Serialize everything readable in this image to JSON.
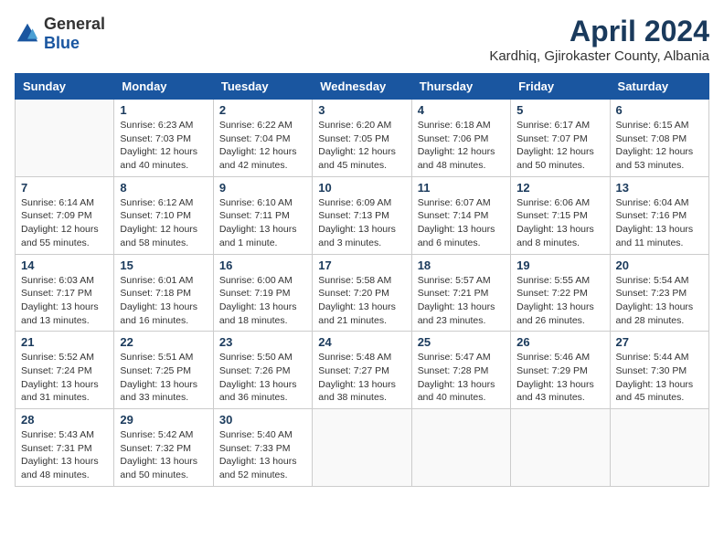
{
  "header": {
    "logo_general": "General",
    "logo_blue": "Blue",
    "month": "April 2024",
    "location": "Kardhiq, Gjirokaster County, Albania"
  },
  "weekdays": [
    "Sunday",
    "Monday",
    "Tuesday",
    "Wednesday",
    "Thursday",
    "Friday",
    "Saturday"
  ],
  "weeks": [
    [
      {
        "date": "",
        "sunrise": "",
        "sunset": "",
        "daylight": ""
      },
      {
        "date": "1",
        "sunrise": "Sunrise: 6:23 AM",
        "sunset": "Sunset: 7:03 PM",
        "daylight": "Daylight: 12 hours and 40 minutes."
      },
      {
        "date": "2",
        "sunrise": "Sunrise: 6:22 AM",
        "sunset": "Sunset: 7:04 PM",
        "daylight": "Daylight: 12 hours and 42 minutes."
      },
      {
        "date": "3",
        "sunrise": "Sunrise: 6:20 AM",
        "sunset": "Sunset: 7:05 PM",
        "daylight": "Daylight: 12 hours and 45 minutes."
      },
      {
        "date": "4",
        "sunrise": "Sunrise: 6:18 AM",
        "sunset": "Sunset: 7:06 PM",
        "daylight": "Daylight: 12 hours and 48 minutes."
      },
      {
        "date": "5",
        "sunrise": "Sunrise: 6:17 AM",
        "sunset": "Sunset: 7:07 PM",
        "daylight": "Daylight: 12 hours and 50 minutes."
      },
      {
        "date": "6",
        "sunrise": "Sunrise: 6:15 AM",
        "sunset": "Sunset: 7:08 PM",
        "daylight": "Daylight: 12 hours and 53 minutes."
      }
    ],
    [
      {
        "date": "7",
        "sunrise": "Sunrise: 6:14 AM",
        "sunset": "Sunset: 7:09 PM",
        "daylight": "Daylight: 12 hours and 55 minutes."
      },
      {
        "date": "8",
        "sunrise": "Sunrise: 6:12 AM",
        "sunset": "Sunset: 7:10 PM",
        "daylight": "Daylight: 12 hours and 58 minutes."
      },
      {
        "date": "9",
        "sunrise": "Sunrise: 6:10 AM",
        "sunset": "Sunset: 7:11 PM",
        "daylight": "Daylight: 13 hours and 1 minute."
      },
      {
        "date": "10",
        "sunrise": "Sunrise: 6:09 AM",
        "sunset": "Sunset: 7:13 PM",
        "daylight": "Daylight: 13 hours and 3 minutes."
      },
      {
        "date": "11",
        "sunrise": "Sunrise: 6:07 AM",
        "sunset": "Sunset: 7:14 PM",
        "daylight": "Daylight: 13 hours and 6 minutes."
      },
      {
        "date": "12",
        "sunrise": "Sunrise: 6:06 AM",
        "sunset": "Sunset: 7:15 PM",
        "daylight": "Daylight: 13 hours and 8 minutes."
      },
      {
        "date": "13",
        "sunrise": "Sunrise: 6:04 AM",
        "sunset": "Sunset: 7:16 PM",
        "daylight": "Daylight: 13 hours and 11 minutes."
      }
    ],
    [
      {
        "date": "14",
        "sunrise": "Sunrise: 6:03 AM",
        "sunset": "Sunset: 7:17 PM",
        "daylight": "Daylight: 13 hours and 13 minutes."
      },
      {
        "date": "15",
        "sunrise": "Sunrise: 6:01 AM",
        "sunset": "Sunset: 7:18 PM",
        "daylight": "Daylight: 13 hours and 16 minutes."
      },
      {
        "date": "16",
        "sunrise": "Sunrise: 6:00 AM",
        "sunset": "Sunset: 7:19 PM",
        "daylight": "Daylight: 13 hours and 18 minutes."
      },
      {
        "date": "17",
        "sunrise": "Sunrise: 5:58 AM",
        "sunset": "Sunset: 7:20 PM",
        "daylight": "Daylight: 13 hours and 21 minutes."
      },
      {
        "date": "18",
        "sunrise": "Sunrise: 5:57 AM",
        "sunset": "Sunset: 7:21 PM",
        "daylight": "Daylight: 13 hours and 23 minutes."
      },
      {
        "date": "19",
        "sunrise": "Sunrise: 5:55 AM",
        "sunset": "Sunset: 7:22 PM",
        "daylight": "Daylight: 13 hours and 26 minutes."
      },
      {
        "date": "20",
        "sunrise": "Sunrise: 5:54 AM",
        "sunset": "Sunset: 7:23 PM",
        "daylight": "Daylight: 13 hours and 28 minutes."
      }
    ],
    [
      {
        "date": "21",
        "sunrise": "Sunrise: 5:52 AM",
        "sunset": "Sunset: 7:24 PM",
        "daylight": "Daylight: 13 hours and 31 minutes."
      },
      {
        "date": "22",
        "sunrise": "Sunrise: 5:51 AM",
        "sunset": "Sunset: 7:25 PM",
        "daylight": "Daylight: 13 hours and 33 minutes."
      },
      {
        "date": "23",
        "sunrise": "Sunrise: 5:50 AM",
        "sunset": "Sunset: 7:26 PM",
        "daylight": "Daylight: 13 hours and 36 minutes."
      },
      {
        "date": "24",
        "sunrise": "Sunrise: 5:48 AM",
        "sunset": "Sunset: 7:27 PM",
        "daylight": "Daylight: 13 hours and 38 minutes."
      },
      {
        "date": "25",
        "sunrise": "Sunrise: 5:47 AM",
        "sunset": "Sunset: 7:28 PM",
        "daylight": "Daylight: 13 hours and 40 minutes."
      },
      {
        "date": "26",
        "sunrise": "Sunrise: 5:46 AM",
        "sunset": "Sunset: 7:29 PM",
        "daylight": "Daylight: 13 hours and 43 minutes."
      },
      {
        "date": "27",
        "sunrise": "Sunrise: 5:44 AM",
        "sunset": "Sunset: 7:30 PM",
        "daylight": "Daylight: 13 hours and 45 minutes."
      }
    ],
    [
      {
        "date": "28",
        "sunrise": "Sunrise: 5:43 AM",
        "sunset": "Sunset: 7:31 PM",
        "daylight": "Daylight: 13 hours and 48 minutes."
      },
      {
        "date": "29",
        "sunrise": "Sunrise: 5:42 AM",
        "sunset": "Sunset: 7:32 PM",
        "daylight": "Daylight: 13 hours and 50 minutes."
      },
      {
        "date": "30",
        "sunrise": "Sunrise: 5:40 AM",
        "sunset": "Sunset: 7:33 PM",
        "daylight": "Daylight: 13 hours and 52 minutes."
      },
      {
        "date": "",
        "sunrise": "",
        "sunset": "",
        "daylight": ""
      },
      {
        "date": "",
        "sunrise": "",
        "sunset": "",
        "daylight": ""
      },
      {
        "date": "",
        "sunrise": "",
        "sunset": "",
        "daylight": ""
      },
      {
        "date": "",
        "sunrise": "",
        "sunset": "",
        "daylight": ""
      }
    ]
  ]
}
